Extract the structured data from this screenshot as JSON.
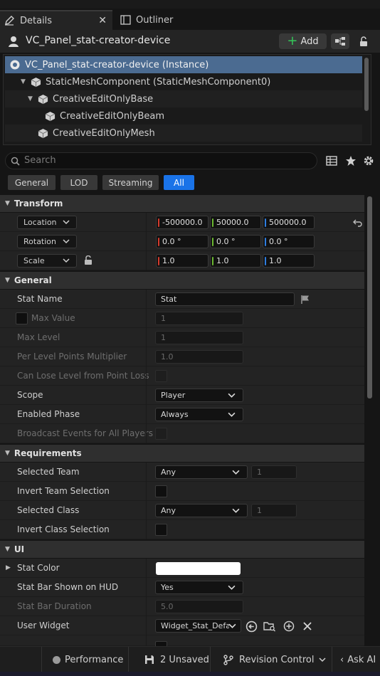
{
  "tabs": {
    "details": "Details",
    "outliner": "Outliner"
  },
  "header": {
    "title": "VC_Panel_stat-creator-device",
    "add_label": "Add"
  },
  "tree": [
    {
      "label": "VC_Panel_stat-creator-device (Instance)",
      "selected": true
    },
    {
      "label": "StaticMeshComponent (StaticMeshComponent0)"
    },
    {
      "label": "CreativeEditOnlyBase"
    },
    {
      "label": "CreativeEditOnlyBeam"
    },
    {
      "label": "CreativeEditOnlyMesh"
    }
  ],
  "search": {
    "placeholder": "Search"
  },
  "filters": [
    "General",
    "LOD",
    "Streaming",
    "All"
  ],
  "sections": {
    "transform": "Transform",
    "general": "General",
    "requirements": "Requirements",
    "ui": "UI"
  },
  "transform": {
    "location": {
      "label": "Location",
      "x": "-500000.0",
      "y": "50000.0",
      "z": "500000.0"
    },
    "rotation": {
      "label": "Rotation",
      "x": "0.0 °",
      "y": "0.0 °",
      "z": "0.0 °"
    },
    "scale": {
      "label": "Scale",
      "x": "1.0",
      "y": "1.0",
      "z": "1.0"
    }
  },
  "general": {
    "stat_name": {
      "label": "Stat Name",
      "value": "Stat"
    },
    "max_value": {
      "label": "Max Value",
      "value": "1"
    },
    "max_level": {
      "label": "Max Level",
      "value": "1"
    },
    "per_level": {
      "label": "Per Level Points Multiplier",
      "value": "1.0"
    },
    "can_lose": {
      "label": "Can Lose Level from Point Loss"
    },
    "scope": {
      "label": "Scope",
      "value": "Player"
    },
    "enabled_phase": {
      "label": "Enabled Phase",
      "value": "Always"
    },
    "broadcast": {
      "label": "Broadcast Events for All Players"
    }
  },
  "requirements": {
    "selected_team": {
      "label": "Selected Team",
      "value": "Any",
      "index": "1"
    },
    "invert_team": {
      "label": "Invert Team Selection"
    },
    "selected_class": {
      "label": "Selected Class",
      "value": "Any",
      "index": "1"
    },
    "invert_class": {
      "label": "Invert Class Selection"
    }
  },
  "ui": {
    "stat_color": {
      "label": "Stat Color",
      "color": "#ffffff"
    },
    "bar_shown": {
      "label": "Stat Bar Shown on HUD",
      "value": "Yes"
    },
    "bar_duration": {
      "label": "Stat Bar Duration",
      "value": "5.0"
    },
    "user_widget": {
      "label": "User Widget",
      "value": "Widget_Stat_Defa"
    }
  },
  "bottom": {
    "performance": "Performance",
    "unsaved": "2 Unsaved",
    "revision": "Revision Control",
    "ask_ai": "Ask AI"
  },
  "colors": {
    "accent": "#1a73e8",
    "selection": "#4b6b91",
    "x_axis": "#d33a2c",
    "y_axis": "#6ab630",
    "z_axis": "#2e7de0"
  }
}
